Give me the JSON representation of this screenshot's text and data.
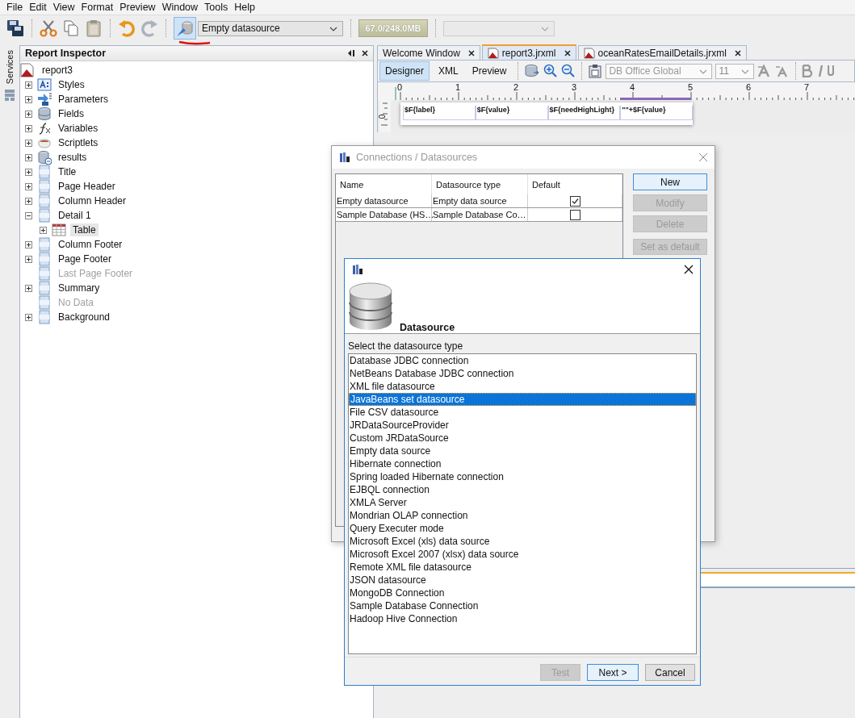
{
  "menu": [
    "File",
    "Edit",
    "View",
    "Format",
    "Preview",
    "Window",
    "Tools",
    "Help"
  ],
  "toolbar": {
    "datasource": "Empty datasource",
    "memory": "67.0/248.0MB"
  },
  "side_strip": {
    "label": "Services"
  },
  "inspector": {
    "title": "Report Inspector",
    "root": "report3",
    "items": [
      {
        "label": "Styles",
        "kind": "styles",
        "expanded": false,
        "disabled": false,
        "selected": false
      },
      {
        "label": "Parameters",
        "kind": "parameters",
        "expanded": false,
        "disabled": false,
        "selected": false
      },
      {
        "label": "Fields",
        "kind": "fields",
        "expanded": false,
        "disabled": false,
        "selected": false
      },
      {
        "label": "Variables",
        "kind": "variables",
        "expanded": false,
        "disabled": false,
        "selected": false
      },
      {
        "label": "Scriptlets",
        "kind": "scriptlets",
        "expanded": false,
        "disabled": false,
        "selected": false
      },
      {
        "label": "results",
        "kind": "dataset",
        "expanded": false,
        "disabled": false,
        "selected": false
      },
      {
        "label": "Title",
        "kind": "band",
        "expanded": false,
        "disabled": false,
        "selected": false
      },
      {
        "label": "Page Header",
        "kind": "band",
        "expanded": false,
        "disabled": false,
        "selected": false
      },
      {
        "label": "Column Header",
        "kind": "band",
        "expanded": false,
        "disabled": false,
        "selected": false
      },
      {
        "label": "Detail 1",
        "kind": "band",
        "expanded": true,
        "disabled": false,
        "selected": false,
        "children": [
          {
            "label": "Table",
            "kind": "table",
            "expanded": false,
            "disabled": false,
            "selected": true
          }
        ]
      },
      {
        "label": "Column Footer",
        "kind": "band",
        "expanded": false,
        "disabled": false,
        "selected": false
      },
      {
        "label": "Page Footer",
        "kind": "band",
        "expanded": false,
        "disabled": false,
        "selected": false
      },
      {
        "label": "Last Page Footer",
        "kind": "band",
        "disabled": true,
        "selected": false
      },
      {
        "label": "Summary",
        "kind": "band",
        "expanded": false,
        "disabled": false,
        "selected": false
      },
      {
        "label": "No Data",
        "kind": "band",
        "disabled": true,
        "selected": false
      },
      {
        "label": "Background",
        "kind": "band",
        "expanded": false,
        "disabled": false,
        "selected": false
      }
    ]
  },
  "editor": {
    "tabs": [
      {
        "label": "Welcome Window",
        "selected": false,
        "kind": "plain"
      },
      {
        "label": "report3.jrxml",
        "selected": true,
        "kind": "report"
      },
      {
        "label": "oceanRatesEmailDetails.jrxml",
        "selected": false,
        "kind": "report"
      }
    ],
    "views": [
      {
        "label": "Designer",
        "selected": true
      },
      {
        "label": "XML",
        "selected": false
      },
      {
        "label": "Preview",
        "selected": false
      }
    ],
    "font": "DB Office Global",
    "size": "11",
    "ruler": [
      "0",
      "1",
      "2",
      "3",
      "4",
      "5",
      "6",
      "7"
    ],
    "vruler": "0",
    "fields": [
      "$F{label}",
      "$F{value}",
      "$F{needHighLight}",
      "\"\"+$F{value}"
    ]
  },
  "connections": {
    "title": "Connections / Datasources",
    "columns": [
      "Name",
      "Datasource type",
      "Default"
    ],
    "rows": [
      {
        "name": "Empty datasource",
        "type": "Empty data source",
        "checked": true
      },
      {
        "name": "Sample Database (HS…",
        "type": "Sample Database Co…",
        "checked": false
      }
    ],
    "buttons": [
      {
        "label": "New",
        "disabled": false,
        "selected": true
      },
      {
        "label": "Modify",
        "disabled": true,
        "selected": false
      },
      {
        "label": "Delete",
        "disabled": true,
        "selected": false
      },
      {
        "label": "Set as default",
        "disabled": true,
        "selected": false
      }
    ]
  },
  "wizard": {
    "heading": "Datasource",
    "prompt": "Select the datasource type",
    "items": [
      {
        "label": "Database JDBC connection",
        "selected": false
      },
      {
        "label": "NetBeans Database JDBC connection",
        "selected": false
      },
      {
        "label": "XML file datasource",
        "selected": false
      },
      {
        "label": "JavaBeans set datasource",
        "selected": true
      },
      {
        "label": "File CSV datasource",
        "selected": false
      },
      {
        "label": "JRDataSourceProvider",
        "selected": false
      },
      {
        "label": "Custom JRDataSource",
        "selected": false
      },
      {
        "label": "Empty data source",
        "selected": false
      },
      {
        "label": "Hibernate connection",
        "selected": false
      },
      {
        "label": "Spring loaded Hibernate connection",
        "selected": false
      },
      {
        "label": "EJBQL connection",
        "selected": false
      },
      {
        "label": "XMLA Server",
        "selected": false
      },
      {
        "label": "Mondrian OLAP connection",
        "selected": false
      },
      {
        "label": "Query Executer mode",
        "selected": false
      },
      {
        "label": "Microsoft Excel (xls) data source",
        "selected": false
      },
      {
        "label": "Microsoft Excel 2007 (xlsx) data source",
        "selected": false
      },
      {
        "label": "Remote XML file datasource",
        "selected": false
      },
      {
        "label": "JSON datasource",
        "selected": false
      },
      {
        "label": "MongoDB Connection",
        "selected": false
      },
      {
        "label": "Sample Database Connection",
        "selected": false
      },
      {
        "label": "Hadoop Hive Connection",
        "selected": false
      }
    ],
    "buttons": [
      {
        "label": "Test",
        "disabled": true,
        "selected": false
      },
      {
        "label": "Next >",
        "disabled": false,
        "selected": true
      },
      {
        "label": "Cancel",
        "disabled": false,
        "selected": false
      }
    ]
  }
}
